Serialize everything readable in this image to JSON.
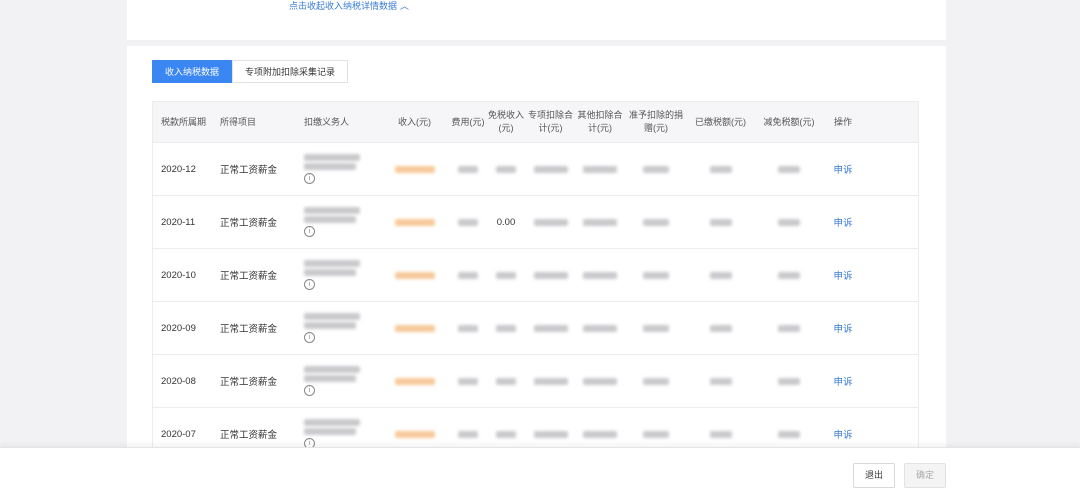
{
  "header": {
    "expand_link": "点击收起收入纳税详情数据",
    "expand_icon": "chevron-up-icon"
  },
  "tabs": [
    {
      "label": "收入纳税数据",
      "active": true
    },
    {
      "label": "专项附加扣除采集记录",
      "active": false
    }
  ],
  "table": {
    "columns": [
      "税款所属期",
      "所得项目",
      "扣缴义务人",
      "收入(元)",
      "费用(元)",
      "免税收入(元)",
      "专项扣除合计(元)",
      "其他扣除合计(元)",
      "准予扣除的捐赠(元)",
      "已缴税额(元)",
      "减免税额(元)",
      "操作"
    ],
    "rows": [
      {
        "period": "2020-12",
        "item": "正常工资薪金",
        "action": "申诉",
        "tax_free": ""
      },
      {
        "period": "2020-11",
        "item": "正常工资薪金",
        "action": "申诉",
        "tax_free": "0.00"
      },
      {
        "period": "2020-10",
        "item": "正常工资薪金",
        "action": "申诉",
        "tax_free": ""
      },
      {
        "period": "2020-09",
        "item": "正常工资薪金",
        "action": "申诉",
        "tax_free": ""
      },
      {
        "period": "2020-08",
        "item": "正常工资薪金",
        "action": "申诉",
        "tax_free": ""
      },
      {
        "period": "2020-07",
        "item": "正常工资薪金",
        "action": "申诉",
        "tax_free": ""
      }
    ]
  },
  "footer": {
    "exit_label": "退出",
    "confirm_label": "确定"
  },
  "colors": {
    "accent": "#3a86f2",
    "link": "#3a7bd5",
    "redacted": "#c9c9cc",
    "redacted_income": "#f6c99a"
  }
}
